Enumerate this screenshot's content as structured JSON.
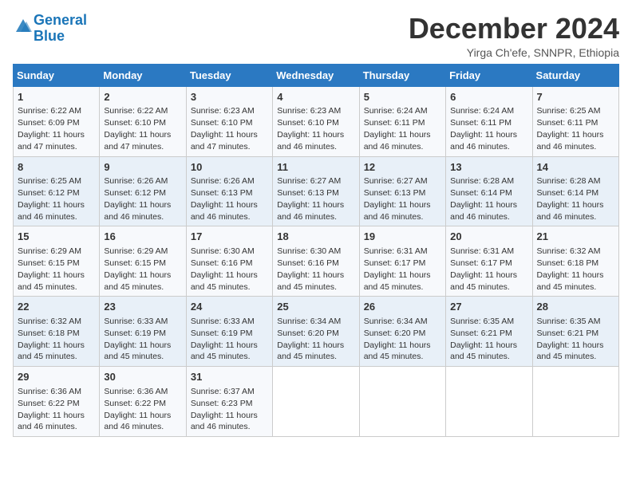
{
  "header": {
    "logo_line1": "General",
    "logo_line2": "Blue",
    "month": "December 2024",
    "location": "Yirga Ch'efe, SNNPR, Ethiopia"
  },
  "days_of_week": [
    "Sunday",
    "Monday",
    "Tuesday",
    "Wednesday",
    "Thursday",
    "Friday",
    "Saturday"
  ],
  "weeks": [
    [
      {
        "day": "1",
        "sunrise": "6:22 AM",
        "sunset": "6:09 PM",
        "daylight": "11 hours and 47 minutes."
      },
      {
        "day": "2",
        "sunrise": "6:22 AM",
        "sunset": "6:10 PM",
        "daylight": "11 hours and 47 minutes."
      },
      {
        "day": "3",
        "sunrise": "6:23 AM",
        "sunset": "6:10 PM",
        "daylight": "11 hours and 47 minutes."
      },
      {
        "day": "4",
        "sunrise": "6:23 AM",
        "sunset": "6:10 PM",
        "daylight": "11 hours and 46 minutes."
      },
      {
        "day": "5",
        "sunrise": "6:24 AM",
        "sunset": "6:11 PM",
        "daylight": "11 hours and 46 minutes."
      },
      {
        "day": "6",
        "sunrise": "6:24 AM",
        "sunset": "6:11 PM",
        "daylight": "11 hours and 46 minutes."
      },
      {
        "day": "7",
        "sunrise": "6:25 AM",
        "sunset": "6:11 PM",
        "daylight": "11 hours and 46 minutes."
      }
    ],
    [
      {
        "day": "8",
        "sunrise": "6:25 AM",
        "sunset": "6:12 PM",
        "daylight": "11 hours and 46 minutes."
      },
      {
        "day": "9",
        "sunrise": "6:26 AM",
        "sunset": "6:12 PM",
        "daylight": "11 hours and 46 minutes."
      },
      {
        "day": "10",
        "sunrise": "6:26 AM",
        "sunset": "6:13 PM",
        "daylight": "11 hours and 46 minutes."
      },
      {
        "day": "11",
        "sunrise": "6:27 AM",
        "sunset": "6:13 PM",
        "daylight": "11 hours and 46 minutes."
      },
      {
        "day": "12",
        "sunrise": "6:27 AM",
        "sunset": "6:13 PM",
        "daylight": "11 hours and 46 minutes."
      },
      {
        "day": "13",
        "sunrise": "6:28 AM",
        "sunset": "6:14 PM",
        "daylight": "11 hours and 46 minutes."
      },
      {
        "day": "14",
        "sunrise": "6:28 AM",
        "sunset": "6:14 PM",
        "daylight": "11 hours and 46 minutes."
      }
    ],
    [
      {
        "day": "15",
        "sunrise": "6:29 AM",
        "sunset": "6:15 PM",
        "daylight": "11 hours and 45 minutes."
      },
      {
        "day": "16",
        "sunrise": "6:29 AM",
        "sunset": "6:15 PM",
        "daylight": "11 hours and 45 minutes."
      },
      {
        "day": "17",
        "sunrise": "6:30 AM",
        "sunset": "6:16 PM",
        "daylight": "11 hours and 45 minutes."
      },
      {
        "day": "18",
        "sunrise": "6:30 AM",
        "sunset": "6:16 PM",
        "daylight": "11 hours and 45 minutes."
      },
      {
        "day": "19",
        "sunrise": "6:31 AM",
        "sunset": "6:17 PM",
        "daylight": "11 hours and 45 minutes."
      },
      {
        "day": "20",
        "sunrise": "6:31 AM",
        "sunset": "6:17 PM",
        "daylight": "11 hours and 45 minutes."
      },
      {
        "day": "21",
        "sunrise": "6:32 AM",
        "sunset": "6:18 PM",
        "daylight": "11 hours and 45 minutes."
      }
    ],
    [
      {
        "day": "22",
        "sunrise": "6:32 AM",
        "sunset": "6:18 PM",
        "daylight": "11 hours and 45 minutes."
      },
      {
        "day": "23",
        "sunrise": "6:33 AM",
        "sunset": "6:19 PM",
        "daylight": "11 hours and 45 minutes."
      },
      {
        "day": "24",
        "sunrise": "6:33 AM",
        "sunset": "6:19 PM",
        "daylight": "11 hours and 45 minutes."
      },
      {
        "day": "25",
        "sunrise": "6:34 AM",
        "sunset": "6:20 PM",
        "daylight": "11 hours and 45 minutes."
      },
      {
        "day": "26",
        "sunrise": "6:34 AM",
        "sunset": "6:20 PM",
        "daylight": "11 hours and 45 minutes."
      },
      {
        "day": "27",
        "sunrise": "6:35 AM",
        "sunset": "6:21 PM",
        "daylight": "11 hours and 45 minutes."
      },
      {
        "day": "28",
        "sunrise": "6:35 AM",
        "sunset": "6:21 PM",
        "daylight": "11 hours and 45 minutes."
      }
    ],
    [
      {
        "day": "29",
        "sunrise": "6:36 AM",
        "sunset": "6:22 PM",
        "daylight": "11 hours and 46 minutes."
      },
      {
        "day": "30",
        "sunrise": "6:36 AM",
        "sunset": "6:22 PM",
        "daylight": "11 hours and 46 minutes."
      },
      {
        "day": "31",
        "sunrise": "6:37 AM",
        "sunset": "6:23 PM",
        "daylight": "11 hours and 46 minutes."
      },
      null,
      null,
      null,
      null
    ]
  ]
}
